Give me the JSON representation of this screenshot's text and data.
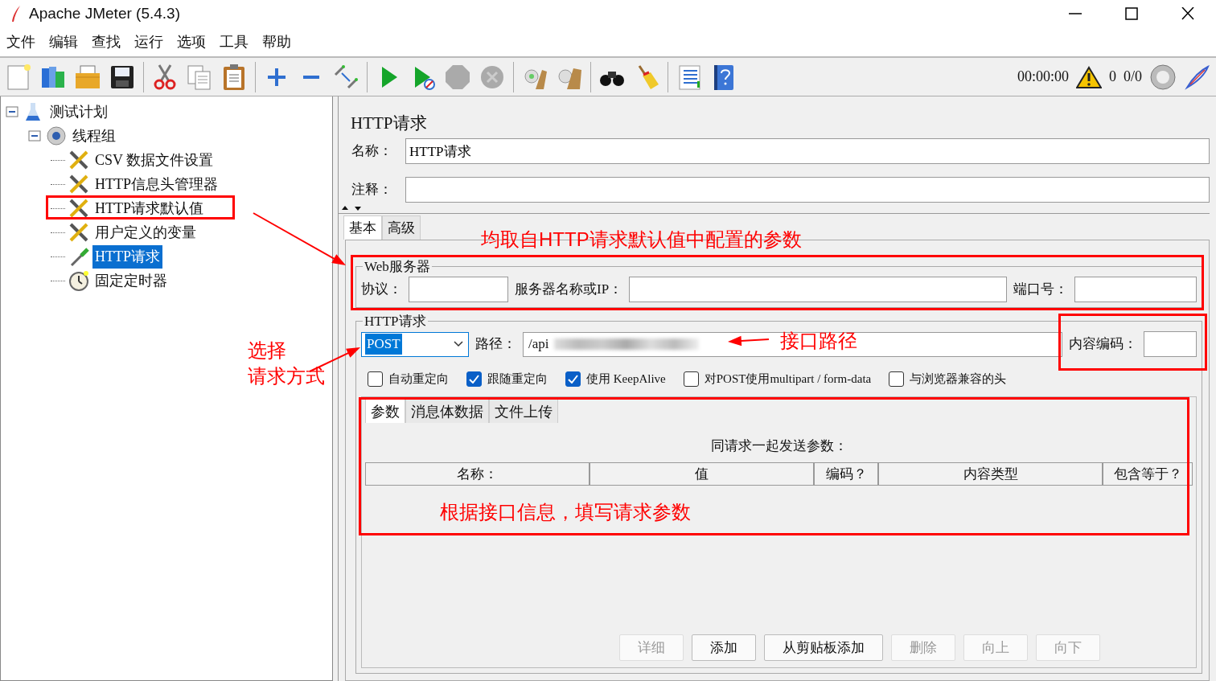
{
  "window": {
    "title": "Apache JMeter (5.4.3)"
  },
  "menu": [
    "文件",
    "编辑",
    "查找",
    "运行",
    "选项",
    "工具",
    "帮助"
  ],
  "status": {
    "timer": "00:00:00",
    "warnings": "0",
    "threads": "0/0"
  },
  "tree": [
    {
      "label": "测试计划",
      "kind": "plan",
      "expanded": true,
      "selected": false,
      "children": [
        {
          "label": "线程组",
          "kind": "thread-group",
          "expanded": true,
          "selected": false,
          "children": [
            {
              "label": "CSV 数据文件设置",
              "kind": "config",
              "selected": false
            },
            {
              "label": "HTTP信息头管理器",
              "kind": "config",
              "selected": false
            },
            {
              "label": "HTTP请求默认值",
              "kind": "config",
              "selected": false
            },
            {
              "label": "用户定义的变量",
              "kind": "config",
              "selected": false
            },
            {
              "label": "HTTP请求",
              "kind": "sampler",
              "selected": true
            },
            {
              "label": "固定定时器",
              "kind": "timer",
              "selected": false
            }
          ]
        }
      ]
    }
  ],
  "editor": {
    "title": "HTTP请求",
    "name_label": "名称：",
    "name_value": "HTTP请求",
    "comment_label": "注释：",
    "tabs": [
      {
        "label": "基本",
        "selected": true
      },
      {
        "label": "高级",
        "selected": false
      }
    ],
    "web_server": {
      "legend": "Web服务器",
      "protocol_label": "协议：",
      "server_label": "服务器名称或IP：",
      "port_label": "端口号："
    },
    "http_request": {
      "legend": "HTTP请求",
      "method": "POST",
      "path_label": "路径：",
      "path_value": "/api",
      "encoding_label": "内容编码：",
      "options": [
        {
          "label": "自动重定向",
          "checked": false
        },
        {
          "label": "跟随重定向",
          "checked": true
        },
        {
          "label": "使用 KeepAlive",
          "checked": true
        },
        {
          "label": "对POST使用multipart / form-data",
          "checked": false
        },
        {
          "label": "与浏览器兼容的头",
          "checked": false
        }
      ]
    },
    "param_tabs": [
      {
        "label": "参数",
        "selected": true
      },
      {
        "label": "消息体数据",
        "selected": false
      },
      {
        "label": "文件上传",
        "selected": false
      }
    ],
    "params_caption": "同请求一起发送参数：",
    "columns": [
      "名称：",
      "值",
      "编码？",
      "内容类型",
      "包含等于？"
    ],
    "buttons": [
      {
        "label": "详细",
        "disabled": true
      },
      {
        "label": "添加",
        "disabled": false
      },
      {
        "label": "从剪贴板添加",
        "disabled": false
      },
      {
        "label": "删除",
        "disabled": true
      },
      {
        "label": "向上",
        "disabled": true
      },
      {
        "label": "向下",
        "disabled": true
      }
    ]
  },
  "annotations": [
    {
      "lines": [
        "均取自HTTP请求默认值中配置的参数"
      ]
    },
    {
      "lines": [
        "选择",
        "请求方式"
      ]
    },
    {
      "lines": [
        "接口路径"
      ]
    },
    {
      "lines": [
        "根据接口信息，填写请求参数"
      ]
    }
  ]
}
